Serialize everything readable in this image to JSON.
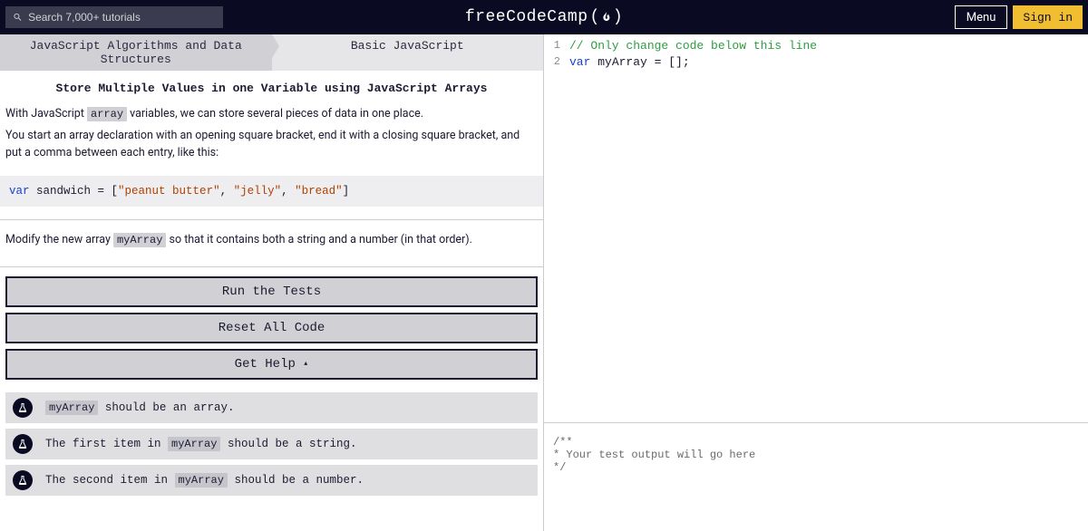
{
  "header": {
    "search_placeholder": "Search 7,000+ tutorials",
    "logo_text": "freeCodeCamp",
    "menu_label": "Menu",
    "signin_label": "Sign in"
  },
  "breadcrumb": {
    "section": "JavaScript Algorithms and Data Structures",
    "subsection": "Basic JavaScript"
  },
  "challenge": {
    "title": "Store Multiple Values in one Variable using JavaScript Arrays",
    "p1_a": "With JavaScript ",
    "p1_code": "array",
    "p1_b": " variables, we can store several pieces of data in one place.",
    "p2": "You start an array declaration with an opening square bracket, end it with a closing square bracket, and put a comma between each entry, like this:",
    "example_kw": "var",
    "example_rest_a": " sandwich = [",
    "example_str1": "\"peanut butter\"",
    "example_sep1": ", ",
    "example_str2": "\"jelly\"",
    "example_sep2": ", ",
    "example_str3": "\"bread\"",
    "example_rest_b": "]",
    "instr_a": "Modify the new array ",
    "instr_code": "myArray",
    "instr_b": " so that it contains both a string and a number (in that order)."
  },
  "buttons": {
    "run": "Run the Tests",
    "reset": "Reset All Code",
    "help": "Get Help "
  },
  "tests": [
    {
      "pre": "",
      "code": "myArray",
      "post": " should be an array."
    },
    {
      "pre": "The first item in ",
      "code": "myArray",
      "post": " should be a string."
    },
    {
      "pre": "The second item in ",
      "code": "myArray",
      "post": " should be a number."
    }
  ],
  "editor": {
    "lines": [
      {
        "num": "1",
        "html": "<span class='com'>// Only change code below this line</span>"
      },
      {
        "num": "2",
        "html": "<span class='kw2'>var</span> <span class='ident'>myArray = [];</span>"
      }
    ]
  },
  "console": "/**\n* Your test output will go here\n*/"
}
